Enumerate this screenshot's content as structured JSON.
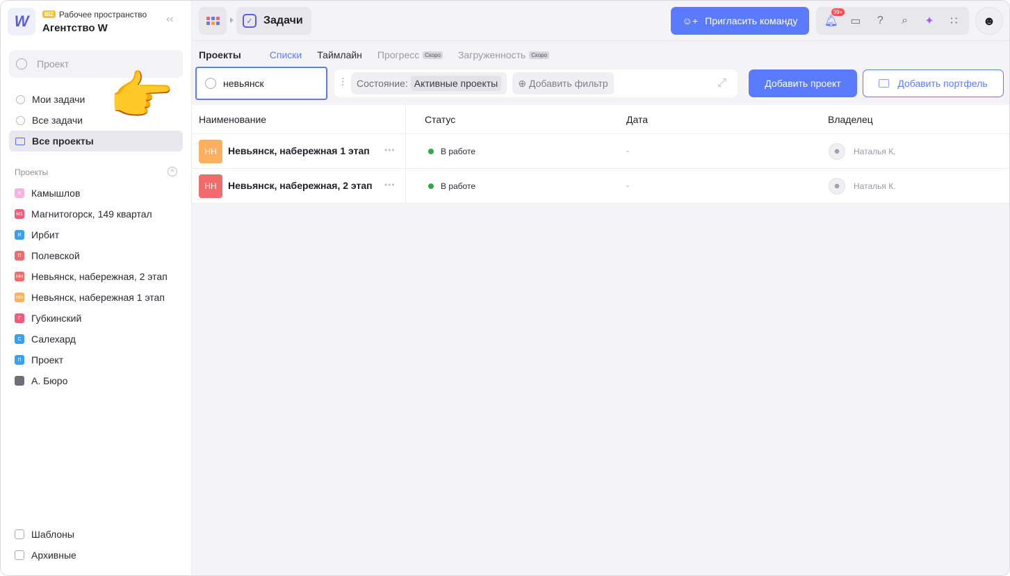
{
  "workspace": {
    "logo": "W",
    "badge": "BIZ",
    "label": "Рабочее пространство",
    "name": "Агентство W"
  },
  "sidebar": {
    "search_placeholder": "Проект",
    "nav": [
      {
        "label": "Мои задачи",
        "icon": "check-circle-icon"
      },
      {
        "label": "Все задачи",
        "icon": "check-circle-icon"
      },
      {
        "label": "Все проекты",
        "icon": "folder-icon",
        "active": true
      }
    ],
    "projects_header": "Проекты",
    "projects": [
      {
        "label": "Камышлов",
        "abbr": "К",
        "color": "#f7b3e0"
      },
      {
        "label": "Магнитогорск, 149 квартал",
        "abbr": "М1",
        "color": "#f25c7a"
      },
      {
        "label": "Ирбит",
        "abbr": "И",
        "color": "#3aa0f5"
      },
      {
        "label": "Полевской",
        "abbr": "П",
        "color": "#f26b6b"
      },
      {
        "label": "Невьянск, набережная, 2 этап",
        "abbr": "НН",
        "color": "#f26b6b"
      },
      {
        "label": "Невьянск, набережная 1 этап",
        "abbr": "НН",
        "color": "#ffb05c"
      },
      {
        "label": "Губкинский",
        "abbr": "Г",
        "color": "#f25c7a"
      },
      {
        "label": "Салехард",
        "abbr": "С",
        "color": "#3aa0f5"
      },
      {
        "label": "Проект",
        "abbr": "П",
        "color": "#3aa0f5"
      },
      {
        "label": "А. Бюро",
        "abbr": "",
        "color": "#6e6e78"
      }
    ],
    "bottom": [
      {
        "label": "Шаблоны",
        "icon": "templates-icon"
      },
      {
        "label": "Архивные",
        "icon": "archive-icon"
      }
    ]
  },
  "topbar": {
    "breadcrumb": "Задачи",
    "invite_label": "Пригласить команду",
    "notifications_badge": "99+"
  },
  "content": {
    "tabs": {
      "title": "Проекты",
      "lists": "Списки",
      "timeline": "Таймлайн",
      "progress": "Прогресс",
      "progress_soon": "Скоро",
      "load": "Загруженность",
      "load_soon": "Скоро"
    },
    "search_value": "невьянск",
    "filter": {
      "state_label": "Состояние:",
      "state_value": "Активные проекты",
      "add_filter": "Добавить фильтр"
    },
    "add_project": "Добавить проект",
    "add_portfolio": "Добавить портфель"
  },
  "table": {
    "columns": [
      "Наименование",
      "Статус",
      "Дата",
      "Владелец"
    ],
    "rows": [
      {
        "abbr": "НН",
        "color": "#ffb05c",
        "name": "Невьянск, набережная 1 этап",
        "status": "В работе",
        "date": "-",
        "owner": "Наталья К."
      },
      {
        "abbr": "НН",
        "color": "#f26b6b",
        "name": "Невьянск, набережная, 2 этап",
        "status": "В работе",
        "date": "-",
        "owner": "Наталья К."
      }
    ]
  },
  "colors": {
    "accent": "#5b7bff",
    "status_green": "#2eaa4a"
  }
}
